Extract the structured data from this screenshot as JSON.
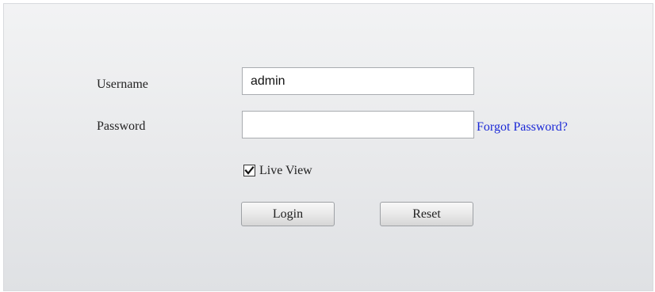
{
  "login_form": {
    "username_label": "Username",
    "username_value": "admin",
    "password_label": "Password",
    "password_value": "",
    "forgot_password_link": "Forgot Password?",
    "live_view_label": "Live View",
    "live_view_checked": true,
    "login_button": "Login",
    "reset_button": "Reset"
  }
}
